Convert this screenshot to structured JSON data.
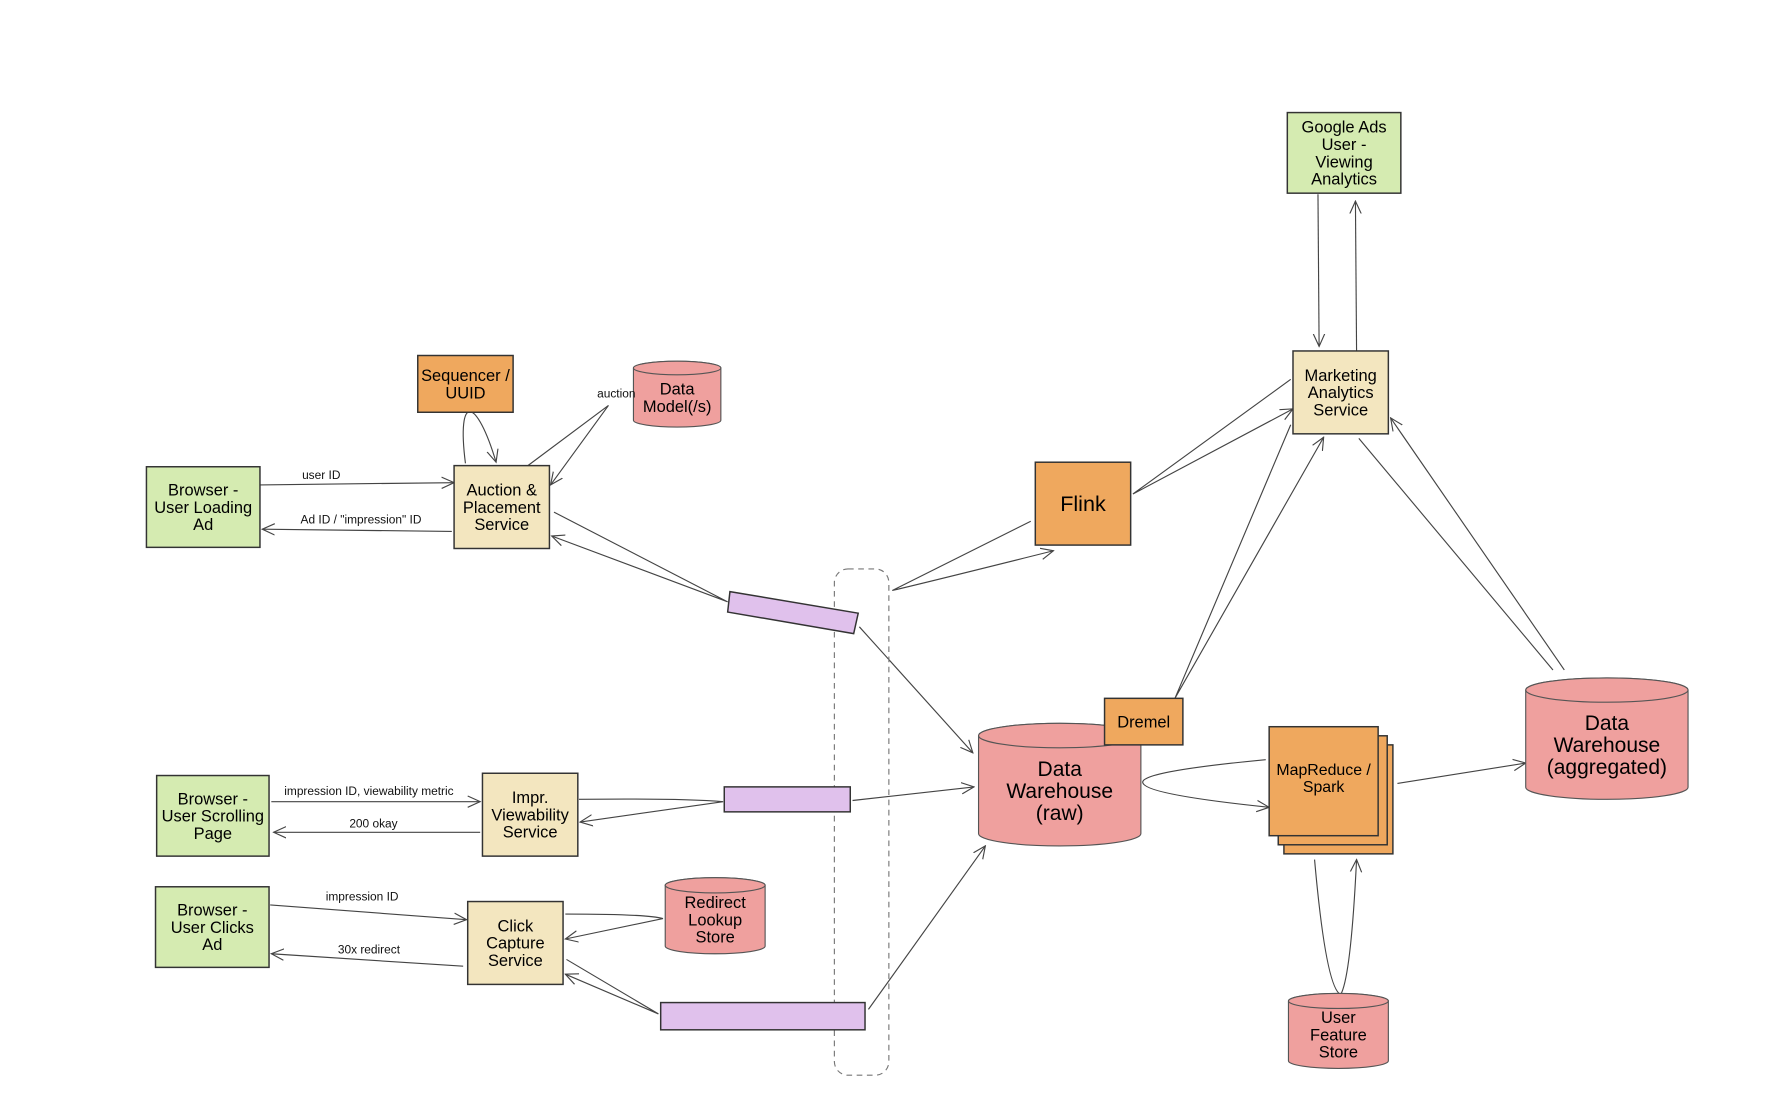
{
  "colors": {
    "client": "#d5ebb1",
    "service": "#f3e6bf",
    "compute": "#efa85e",
    "datastore": "#efa09e",
    "queue": "#e0c1ec",
    "stroke": "#333333"
  },
  "nodes": {
    "sequencer": {
      "kind": "compute",
      "lines": [
        "Sequencer /",
        "UUID"
      ]
    },
    "data_model": {
      "kind": "datastore",
      "lines": [
        "Data",
        "Model(/s)"
      ]
    },
    "browser_loading": {
      "kind": "client",
      "lines": [
        "Browser -",
        "User Loading",
        "Ad"
      ]
    },
    "auction_service": {
      "kind": "service",
      "lines": [
        "Auction &",
        "Placement",
        "Service"
      ]
    },
    "flink": {
      "kind": "compute",
      "lines": [
        "Flink"
      ]
    },
    "google_ads_user": {
      "kind": "client",
      "lines": [
        "Google Ads",
        "User -",
        "Viewing",
        "Analytics"
      ]
    },
    "marketing_service": {
      "kind": "service",
      "lines": [
        "Marketing",
        "Analytics",
        "Service"
      ]
    },
    "dremel": {
      "kind": "compute",
      "lines": [
        "Dremel"
      ]
    },
    "dw_raw": {
      "kind": "datastore",
      "lines": [
        "Data",
        "Warehouse",
        "(raw)"
      ]
    },
    "mapreduce": {
      "kind": "compute",
      "lines": [
        "MapReduce /",
        "Spark"
      ]
    },
    "dw_aggregated": {
      "kind": "datastore",
      "lines": [
        "Data",
        "Warehouse",
        "(aggregated)"
      ]
    },
    "user_feature_store": {
      "kind": "datastore",
      "lines": [
        "User",
        "Feature",
        "Store"
      ]
    },
    "browser_scrolling": {
      "kind": "client",
      "lines": [
        "Browser -",
        "User Scrolling",
        "Page"
      ]
    },
    "impr_service": {
      "kind": "service",
      "lines": [
        "Impr.",
        "Viewability",
        "Service"
      ]
    },
    "browser_clicks": {
      "kind": "client",
      "lines": [
        "Browser -",
        "User Clicks",
        "Ad"
      ]
    },
    "click_service": {
      "kind": "service",
      "lines": [
        "Click",
        "Capture",
        "Service"
      ]
    },
    "redirect_store": {
      "kind": "datastore",
      "lines": [
        "Redirect",
        "Lookup",
        "Store"
      ]
    },
    "queue_auction": {
      "kind": "queue",
      "lines": []
    },
    "queue_impr": {
      "kind": "queue",
      "lines": []
    },
    "queue_click": {
      "kind": "queue",
      "lines": []
    }
  },
  "edge_labels": {
    "user_id": "user ID",
    "ad_id": "Ad ID / \"impression\" ID",
    "auction": "auction",
    "impr_viewability": "impression ID, viewability metric",
    "ok_200": "200 okay",
    "impression_id": "impression ID",
    "redirect_30x": "30x redirect"
  }
}
